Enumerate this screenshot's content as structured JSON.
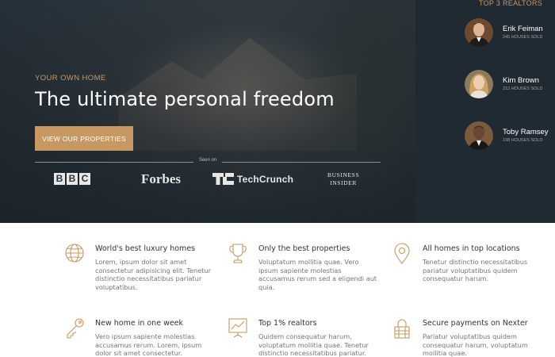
{
  "hero": {
    "eyebrow": "YOUR OWN HOME",
    "headline": "The ultimate personal freedom",
    "cta_label": "VIEW OUR PROPERTIES",
    "seen_on_label": "Seen on",
    "press_logos": {
      "bbc": [
        "B",
        "B",
        "C"
      ],
      "forbes": "Forbes",
      "techcrunch": "TechCrunch",
      "business_insider": [
        "BUSINESS",
        "INSIDER"
      ]
    }
  },
  "realtors": {
    "title": "TOP 3 REALTORS",
    "items": [
      {
        "name": "Erik Feiman",
        "sold": "245 HOUSES SOLD"
      },
      {
        "name": "Kim Brown",
        "sold": "212 HOUSES SOLD"
      },
      {
        "name": "Toby Ramsey",
        "sold": "198 HOUSES SOLD"
      }
    ]
  },
  "features": [
    {
      "icon": "globe-icon",
      "title": "World's best luxury homes",
      "text": "Lorem, ipsum dolor sit amet consectetur adipisicing elit. Tenetur distinctio necessitatibus pariatur voluptatibus."
    },
    {
      "icon": "trophy-icon",
      "title": "Only the best properties",
      "text": "Voluptatum mollitia quae. Vero ipsum sapiente molestias accusamus rerum sed a eligendi aut quia."
    },
    {
      "icon": "map-pin-icon",
      "title": "All homes in top locations",
      "text": "Tenetur distinctio necessitatibus pariatur voluptatibus quidem consequatur harum."
    },
    {
      "icon": "key-icon",
      "title": "New home in one week",
      "text": "Vero ipsum sapiente molestias accusamus rerum. Lorem, ipsum dolor sit amet consectetur."
    },
    {
      "icon": "chart-icon",
      "title": "Top 1% realtors",
      "text": "Quidem consequatur harum, voluptatum mollitia quae. Tenetur distinctio necessitatibus pariatur."
    },
    {
      "icon": "lock-icon",
      "title": "Secure payments on Nexter",
      "text": "Pariatur voluptatibus quidem consequatur harum, voluptatum mollitia quae."
    }
  ],
  "colors": {
    "accent": "#c69963",
    "dark": "#1f2a33",
    "icon": "#c69963"
  }
}
